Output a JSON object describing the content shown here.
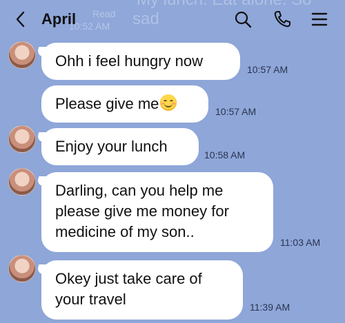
{
  "header": {
    "title": "April",
    "ghost_read_label": "Read",
    "ghost_time": "10:52 AM",
    "ghost_line1": "My lunch. Eat alone. So",
    "ghost_line2": "sad"
  },
  "colors": {
    "background": "#8ea6d8",
    "bubble": "#ffffff",
    "text": "#111111",
    "timestamp": "#2b3350"
  },
  "messages": [
    {
      "text": "Ohh i feel hungry now",
      "time": "10:57 AM",
      "avatar": true
    },
    {
      "text": "Please give me",
      "emoji": "smiling-face-emoji",
      "time": "10:57 AM",
      "avatar": false
    },
    {
      "text": "Enjoy your lunch",
      "time": "10:58 AM",
      "avatar": true
    },
    {
      "lines": [
        "Darling, can you help me",
        "please give me money for",
        "medicine of my son.."
      ],
      "time": "11:03 AM",
      "avatar": true
    },
    {
      "lines": [
        "Okey just take care of",
        "your travel"
      ],
      "time": "11:39 AM",
      "avatar": true
    }
  ],
  "icons": {
    "back": "chevron-left-icon",
    "search": "search-icon",
    "call": "phone-icon",
    "menu": "hamburger-menu-icon",
    "avatar": "contact-avatar"
  }
}
